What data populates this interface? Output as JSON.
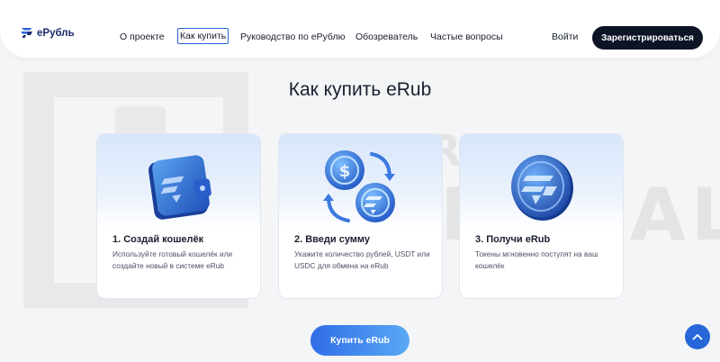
{
  "header": {
    "logo_text": "еРубль",
    "nav": [
      {
        "label": "О проекте"
      },
      {
        "label": "Как купить"
      },
      {
        "label": "Руководство по еРублю"
      },
      {
        "label": "Обозреватель"
      },
      {
        "label": "Частые вопросы"
      }
    ],
    "login_label": "Войти",
    "register_label": "Зарегистрироваться"
  },
  "main": {
    "title": "Как купить eRub",
    "cards": [
      {
        "title": "1. Создай кошелёк",
        "desc": "Используйте готовый кошелёк или создайте новый в системе eRub",
        "image": "wallet-icon"
      },
      {
        "title": "2. Введи сумму",
        "desc": "Укажите количество рублей, USDT или USDC для обмена на eRub",
        "image": "exchange-coins-icon"
      },
      {
        "title": "3. Получи eRub",
        "desc": "Токены мгновенно поступят на ваш кошелёк",
        "image": "erub-coin-icon"
      }
    ],
    "buy_label": "Купить eRub"
  },
  "watermark": {
    "line1": "BROKER",
    "line2": "TRIBUNAL"
  },
  "colors": {
    "accent": "#2867d9",
    "dark_button": "#0d1426"
  }
}
